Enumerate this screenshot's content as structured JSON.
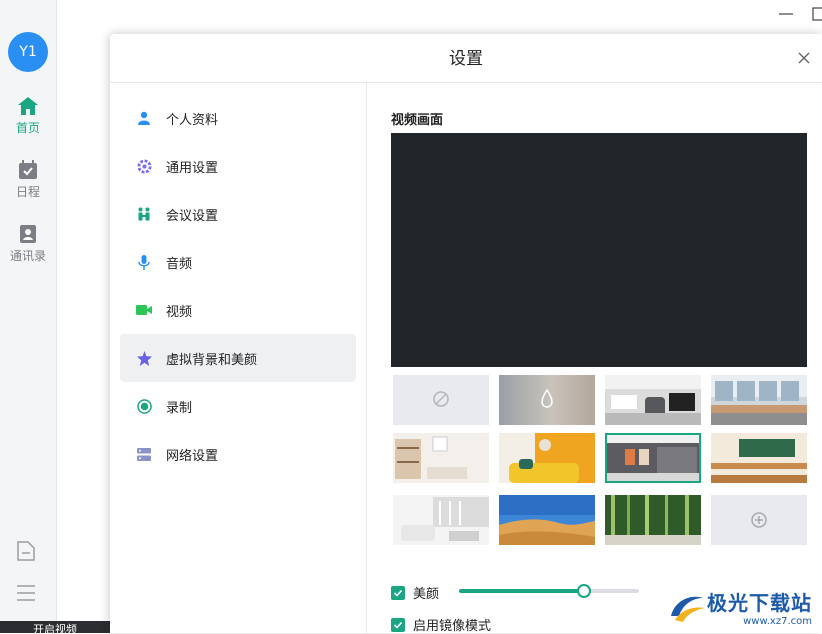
{
  "rail": {
    "avatar_text": "Y1",
    "items": [
      {
        "label": "首页",
        "icon": "home-icon",
        "active": true
      },
      {
        "label": "日程",
        "icon": "calendar-icon",
        "active": false
      },
      {
        "label": "通讯录",
        "icon": "contacts-icon",
        "active": false
      }
    ],
    "start_video_label": "开启视频"
  },
  "dialog": {
    "title": "设置",
    "menu": [
      {
        "label": "个人资料",
        "icon": "person-icon",
        "color": "#2a8ff3"
      },
      {
        "label": "通用设置",
        "icon": "gear-icon",
        "color": "#7b6cf0"
      },
      {
        "label": "会议设置",
        "icon": "meeting-icon",
        "color": "#1aa682"
      },
      {
        "label": "音频",
        "icon": "microphone-icon",
        "color": "#2a8ff3"
      },
      {
        "label": "视频",
        "icon": "video-camera-icon",
        "color": "#2cc55a"
      },
      {
        "label": "虚拟背景和美颜",
        "icon": "sparkle-icon",
        "color": "#6a63e8",
        "active": true
      },
      {
        "label": "录制",
        "icon": "record-icon",
        "color": "#1aa682"
      },
      {
        "label": "网络设置",
        "icon": "network-icon",
        "color": "#8a92c8"
      }
    ],
    "content": {
      "section_title": "视频画面",
      "beauty_label": "美颜",
      "beauty_checked": true,
      "beauty_level": 0.69,
      "mirror_label": "启用镜像模式",
      "mirror_checked": true,
      "selected_background_index": 6
    }
  },
  "watermark": {
    "text": "极光下载站",
    "url": "www.xz7.com"
  },
  "colors": {
    "accent": "#1aa682",
    "avatar": "#2a8ff3",
    "preview_bg": "#232629"
  }
}
